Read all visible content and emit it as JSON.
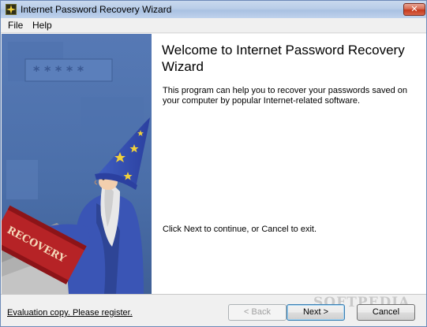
{
  "window": {
    "title": "Internet Password Recovery Wizard",
    "close_glyph": "✕"
  },
  "menu": {
    "items": [
      {
        "label": "File"
      },
      {
        "label": "Help"
      }
    ]
  },
  "side_panel": {
    "banner_mask": "* * * * *",
    "book_label": "RECOVERY"
  },
  "main": {
    "heading": "Welcome to Internet Password Recovery Wizard",
    "intro": "This program can help you to recover your passwords saved on your computer by popular Internet-related software.",
    "continue_text": "Click Next to continue, or Cancel to exit."
  },
  "footer": {
    "eval_link": "Evaluation copy. Please register.",
    "back_label": "< Back",
    "next_label": "Next >",
    "cancel_label": "Cancel",
    "watermark": "SOFTPEDIA"
  },
  "colors": {
    "side_panel_bg": "#4a6ea8",
    "robe": "#3a55b5",
    "book": "#b62326",
    "titlebar": "#b9cde8"
  },
  "icons": [
    "app-wizard-icon",
    "close-icon",
    "star-icon"
  ]
}
